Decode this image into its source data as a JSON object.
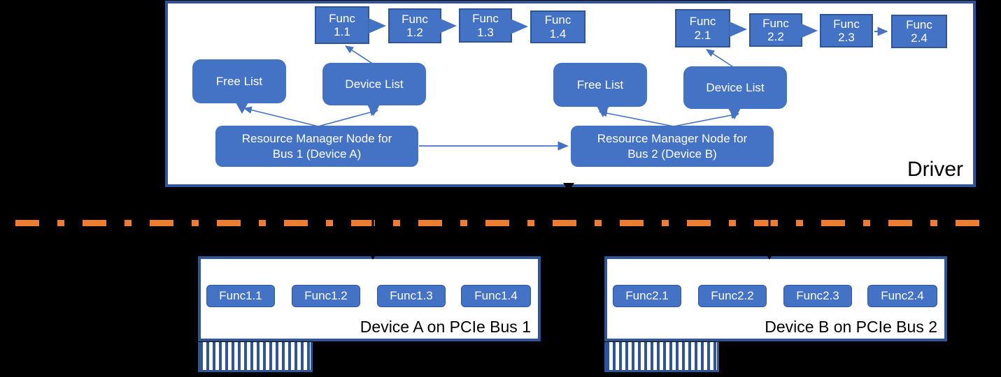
{
  "driver": {
    "label": "Driver",
    "bus1": {
      "funcs": [
        {
          "name": "Func\n1.1"
        },
        {
          "name": "Func\n1.2"
        },
        {
          "name": "Func\n1.3"
        },
        {
          "name": "Func\n1.4"
        }
      ],
      "free_list": "Free List",
      "device_list": "Device List",
      "resource_manager": "Resource Manager Node for\nBus 1 (Device A)"
    },
    "bus2": {
      "funcs": [
        {
          "name": "Func\n2.1"
        },
        {
          "name": "Func\n2.2"
        },
        {
          "name": "Func\n2.3"
        },
        {
          "name": "Func\n2.4"
        }
      ],
      "free_list": "Free List",
      "device_list": "Device List",
      "resource_manager": "Resource Manager Node for\nBus 2 (Device B)"
    }
  },
  "devices": [
    {
      "label": "Device A on PCIe Bus 1",
      "functions": [
        "Func1.1",
        "Func1.2",
        "Func1.3",
        "Func1.4"
      ]
    },
    {
      "label": "Device B on PCIe Bus 2",
      "functions": [
        "Func2.1",
        "Func2.2",
        "Func2.3",
        "Func2.4"
      ]
    }
  ],
  "colors": {
    "node_fill": "#4472C4",
    "node_border": "#2E5597",
    "separator": "#ED7D31",
    "container_bg": "#FFFFFF",
    "background": "#000000",
    "text_on_node": "#FFFFFF",
    "text_on_white": "#000000"
  },
  "separator": {
    "style": "dash-dot",
    "name": "hardware-software-boundary"
  }
}
